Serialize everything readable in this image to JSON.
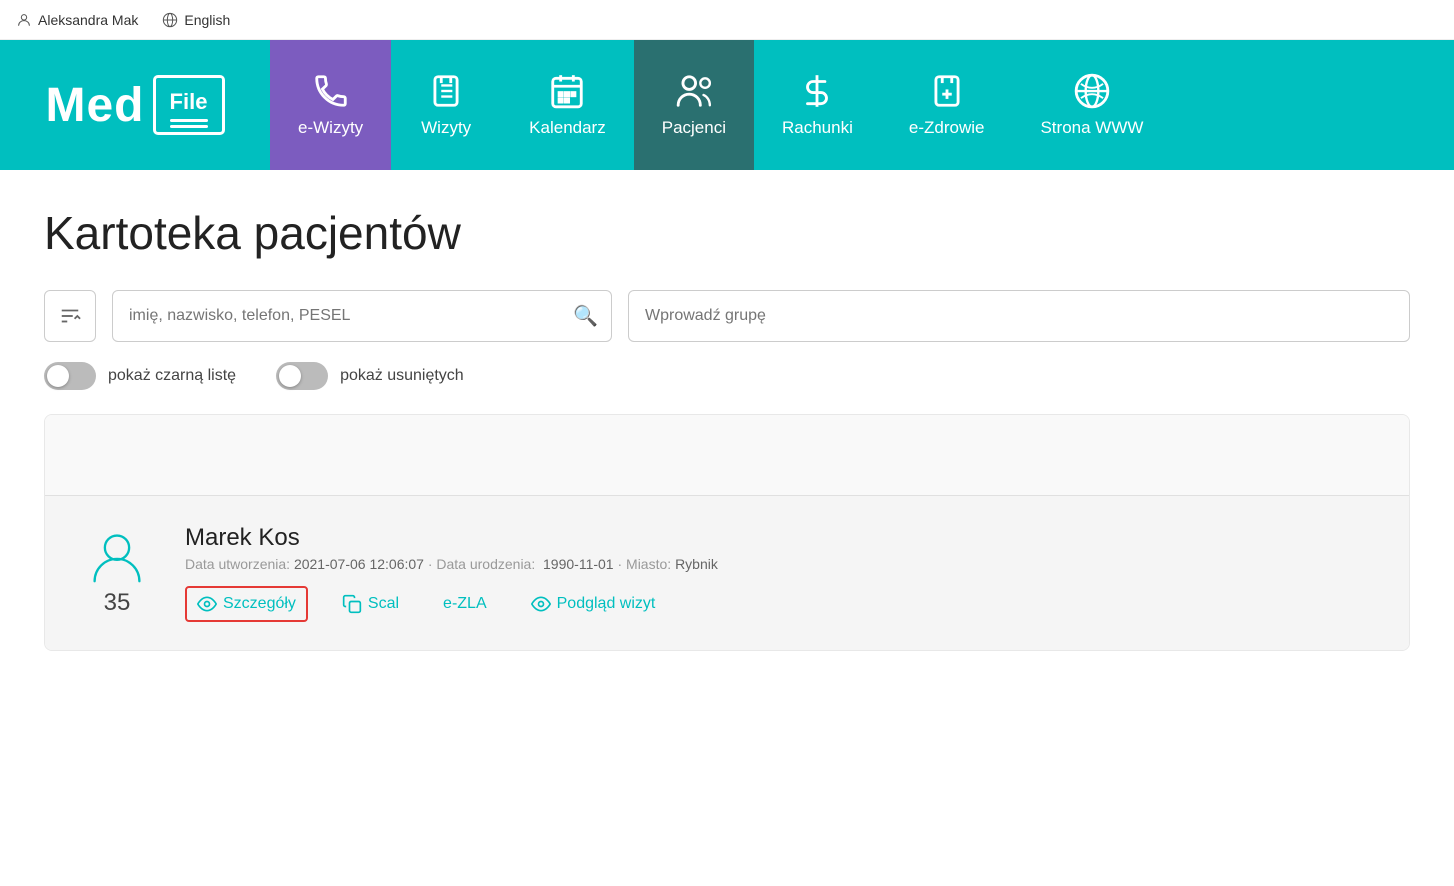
{
  "topbar": {
    "user": "Aleksandra Mak",
    "language": "English"
  },
  "nav": {
    "logo": {
      "med": "Med",
      "file": "File"
    },
    "items": [
      {
        "id": "e-wizyty",
        "label": "e-Wizyty",
        "icon": "phone",
        "active": "purple"
      },
      {
        "id": "wizyty",
        "label": "Wizyty",
        "icon": "clipboard-list",
        "active": ""
      },
      {
        "id": "kalendarz",
        "label": "Kalendarz",
        "icon": "calendar",
        "active": ""
      },
      {
        "id": "pacjenci",
        "label": "Pacjenci",
        "icon": "users",
        "active": "dark"
      },
      {
        "id": "rachunki",
        "label": "Rachunki",
        "icon": "dollar",
        "active": ""
      },
      {
        "id": "e-zdrowie",
        "label": "e-Zdrowie",
        "icon": "clipboard-plus",
        "active": ""
      },
      {
        "id": "strona-www",
        "label": "Strona WWW",
        "icon": "globe",
        "active": ""
      }
    ]
  },
  "page": {
    "title": "Kartoteka pacjentów"
  },
  "search": {
    "placeholder": "imię, nazwisko, telefon, PESEL",
    "group_placeholder": "Wprowadź grupę"
  },
  "toggles": [
    {
      "id": "blacklist",
      "label": "pokaż czarną listę"
    },
    {
      "id": "deleted",
      "label": "pokaż usuniętych"
    }
  ],
  "patients": [
    {
      "name": "Marek Kos",
      "age": "35",
      "created": "2021-07-06 12:06:07",
      "birthdate": "1990-11-01",
      "city": "Rybnik",
      "meta_template": "Data utworzenia: 2021-07-06 12:06:07 · Data urodzenia:  1990-11-01 · Miasto: Rybnik",
      "actions": [
        {
          "id": "szczegoly",
          "label": "Szczegóły",
          "icon": "eye",
          "highlighted": true
        },
        {
          "id": "scal",
          "label": "Scal",
          "icon": "copy",
          "highlighted": false
        },
        {
          "id": "e-zla",
          "label": "e-ZLA",
          "icon": null,
          "highlighted": false
        },
        {
          "id": "podglad-wizyt",
          "label": "Podgląd wizyt",
          "icon": "eye",
          "highlighted": false
        }
      ]
    }
  ]
}
